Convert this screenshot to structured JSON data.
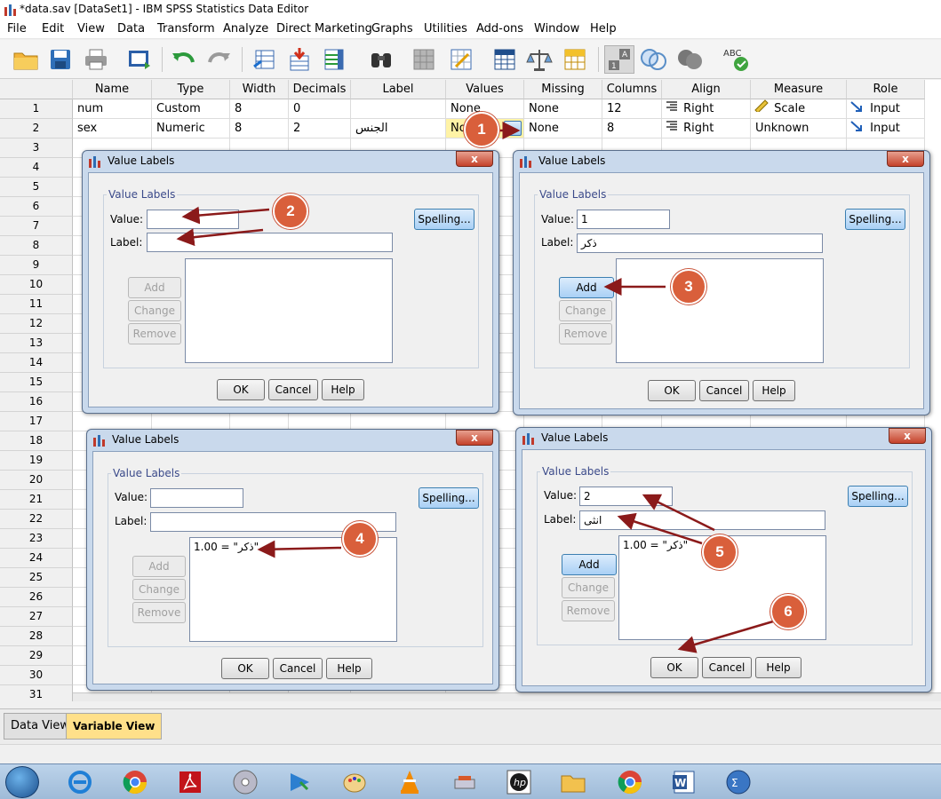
{
  "window": {
    "title": "*data.sav [DataSet1] - IBM SPSS Statistics Data Editor"
  },
  "menu": [
    "File",
    "Edit",
    "View",
    "Data",
    "Transform",
    "Analyze",
    "Direct Marketing",
    "Graphs",
    "Utilities",
    "Add-ons",
    "Window",
    "Help"
  ],
  "toolbar": {
    "icons": [
      "open-folder-icon",
      "save-icon",
      "print-icon",
      "recall-dialog-icon",
      "undo-icon",
      "redo-icon",
      "goto-case-icon",
      "goto-variable-icon",
      "variables-icon",
      "find-icon",
      "insert-cases-icon",
      "insert-variable-icon",
      "split-file-icon",
      "weight-cases-icon",
      "select-cases-icon",
      "value-labels-icon",
      "use-sets-icon",
      "show-all-variables-icon",
      "spell-check-icon"
    ],
    "spell_text": "ABC"
  },
  "grid": {
    "columns": [
      "Name",
      "Type",
      "Width",
      "Decimals",
      "Label",
      "Values",
      "Missing",
      "Columns",
      "Align",
      "Measure",
      "Role"
    ],
    "rows": [
      {
        "num": "1",
        "name": "num",
        "type": "Custom",
        "width": "8",
        "decimals": "0",
        "label": "",
        "values": "None",
        "missing": "None",
        "columns": "12",
        "align": "Right",
        "measure": "Scale",
        "role": "Input"
      },
      {
        "num": "2",
        "name": "sex",
        "type": "Numeric",
        "width": "8",
        "decimals": "2",
        "label": "الجنس",
        "values": "None",
        "missing": "None",
        "columns": "8",
        "align": "Right",
        "measure": "Unknown",
        "role": "Input"
      }
    ],
    "row_numbers": [
      "3",
      "4",
      "5",
      "6",
      "7",
      "8",
      "9",
      "10",
      "11",
      "12",
      "13",
      "14",
      "15",
      "16",
      "17",
      "18",
      "19",
      "20",
      "21",
      "22",
      "23",
      "24",
      "25",
      "26",
      "27",
      "28",
      "29",
      "30",
      "31"
    ]
  },
  "dialogs": [
    {
      "title": "Value Labels",
      "group": "Value Labels",
      "value_label": "Value:",
      "label_label": "Label:",
      "value": "",
      "label": "",
      "list": "",
      "spelling": "Spelling...",
      "add": "Add",
      "change": "Change",
      "remove": "Remove",
      "ok": "OK",
      "cancel": "Cancel",
      "help": "Help",
      "close": "x"
    },
    {
      "title": "Value Labels",
      "group": "Value Labels",
      "value_label": "Value:",
      "label_label": "Label:",
      "value": "1",
      "label": "ذكر",
      "list": "",
      "spelling": "Spelling...",
      "add": "Add",
      "change": "Change",
      "remove": "Remove",
      "ok": "OK",
      "cancel": "Cancel",
      "help": "Help",
      "close": "x"
    },
    {
      "title": "Value Labels",
      "group": "Value Labels",
      "value_label": "Value:",
      "label_label": "Label:",
      "value": "",
      "label": "",
      "list": "1.00 = \"ذكر\"",
      "spelling": "Spelling...",
      "add": "Add",
      "change": "Change",
      "remove": "Remove",
      "ok": "OK",
      "cancel": "Cancel",
      "help": "Help",
      "close": "x"
    },
    {
      "title": "Value Labels",
      "group": "Value Labels",
      "value_label": "Value:",
      "label_label": "Label:",
      "value": "2",
      "label": "انثى",
      "list": "1.00 = \"ذكر\"",
      "spelling": "Spelling...",
      "add": "Add",
      "change": "Change",
      "remove": "Remove",
      "ok": "OK",
      "cancel": "Cancel",
      "help": "Help",
      "close": "x"
    }
  ],
  "annotations": [
    "1",
    "2",
    "3",
    "4",
    "5",
    "6"
  ],
  "tabs": {
    "data_view": "Data View",
    "variable_view": "Variable View"
  },
  "taskbar": {
    "icons": [
      "start-orb-icon",
      "internet-explorer-icon",
      "chrome-icon",
      "acrobat-icon",
      "dvd-icon",
      "media-center-icon",
      "paint-icon",
      "vlc-icon",
      "usb-drive-icon",
      "hp-icon",
      "folder-icon",
      "chrome-icon",
      "word-icon",
      "spss-icon"
    ]
  },
  "colors": {
    "accent": "#d95f3b",
    "arrow": "#8b1a1a",
    "dialog_frame": "#c9d9ec",
    "active_tab": "#ffe08a"
  }
}
